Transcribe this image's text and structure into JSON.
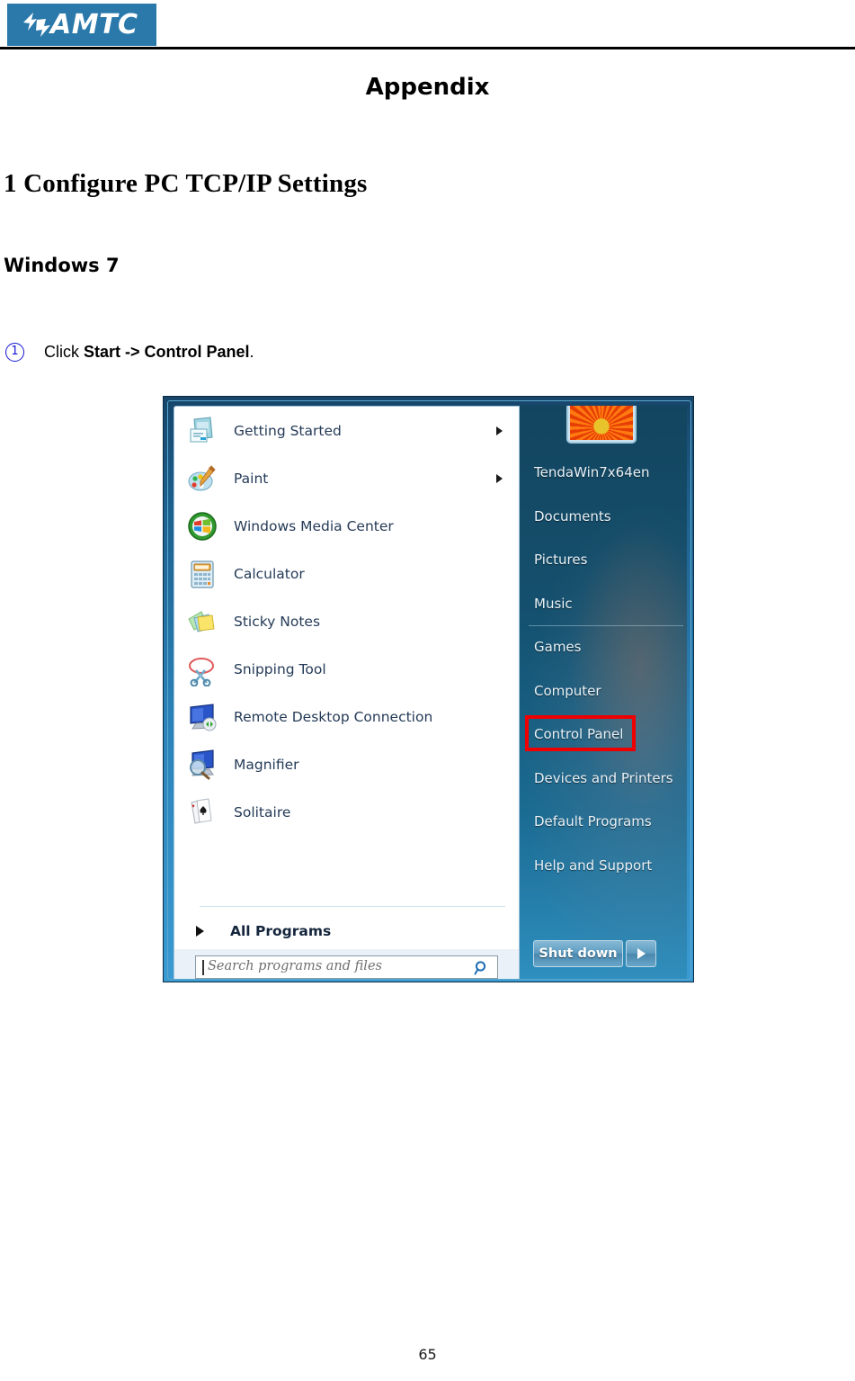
{
  "header": {
    "logo_text": "AMTC",
    "logo_bg_color": "#2b79ab"
  },
  "document": {
    "title": "Appendix",
    "section_heading": "1 Configure PC TCP/IP Settings",
    "subsection_heading": "Windows 7",
    "page_number": "65"
  },
  "step": {
    "bullet": "1",
    "prefix": "Click ",
    "bold": "Start -> Control Panel",
    "suffix": ".",
    "bullet_color": "#1414d2"
  },
  "start_menu": {
    "programs": [
      {
        "label": "Getting Started",
        "icon": "getting-started-icon",
        "has_submenu": true
      },
      {
        "label": "Paint",
        "icon": "paint-icon",
        "has_submenu": true
      },
      {
        "label": "Windows Media Center",
        "icon": "windows-media-center-icon",
        "has_submenu": false
      },
      {
        "label": "Calculator",
        "icon": "calculator-icon",
        "has_submenu": false
      },
      {
        "label": "Sticky Notes",
        "icon": "sticky-notes-icon",
        "has_submenu": false
      },
      {
        "label": "Snipping Tool",
        "icon": "snipping-tool-icon",
        "has_submenu": false
      },
      {
        "label": "Remote Desktop Connection",
        "icon": "remote-desktop-icon",
        "has_submenu": false
      },
      {
        "label": "Magnifier",
        "icon": "magnifier-icon",
        "has_submenu": false
      },
      {
        "label": "Solitaire",
        "icon": "solitaire-icon",
        "has_submenu": false
      }
    ],
    "all_programs_label": "All Programs",
    "search_placeholder": "Search programs and files",
    "search_value": "",
    "user_name": "TendaWin7x64en",
    "right_items": [
      {
        "label": "Documents",
        "separator_above": false,
        "highlighted": false
      },
      {
        "label": "Pictures",
        "separator_above": false,
        "highlighted": false
      },
      {
        "label": "Music",
        "separator_above": false,
        "highlighted": false
      },
      {
        "label": "Games",
        "separator_above": true,
        "highlighted": false
      },
      {
        "label": "Computer",
        "separator_above": false,
        "highlighted": false
      },
      {
        "label": "Control Panel",
        "separator_above": false,
        "highlighted": true
      },
      {
        "label": "Devices and Printers",
        "separator_above": false,
        "highlighted": false
      },
      {
        "label": "Default Programs",
        "separator_above": false,
        "highlighted": false
      },
      {
        "label": "Help and Support",
        "separator_above": false,
        "highlighted": false
      }
    ],
    "shutdown_label": "Shut down",
    "highlight_color": "#ef0000"
  }
}
